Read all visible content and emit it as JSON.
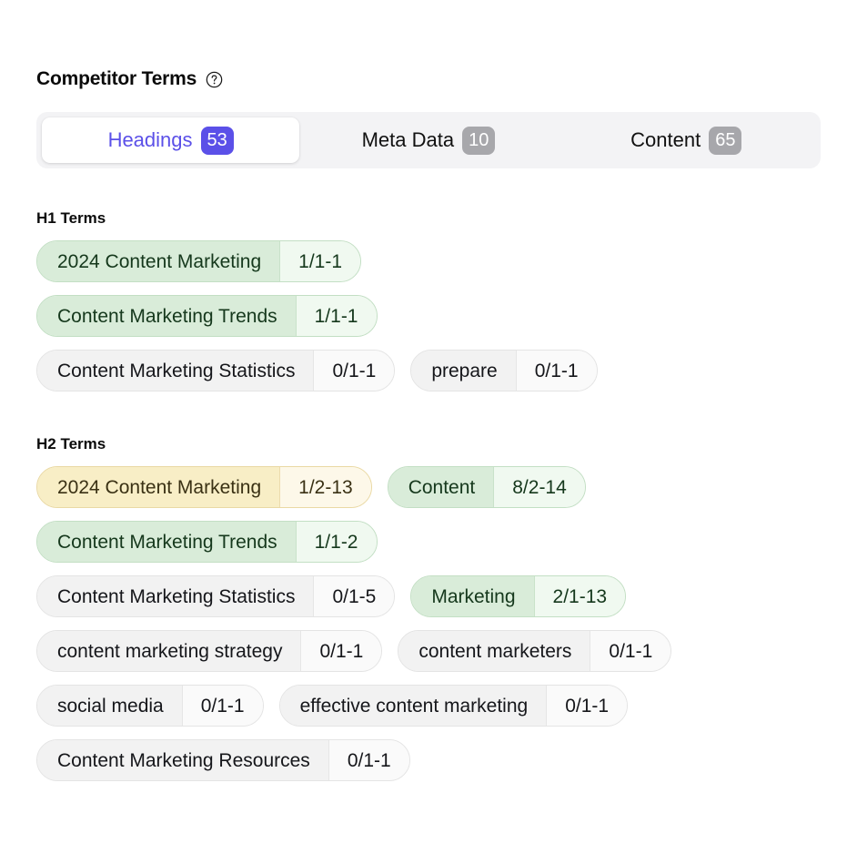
{
  "panel": {
    "title": "Competitor Terms",
    "help_icon": "question-circle-icon"
  },
  "tabs": [
    {
      "label": "Headings",
      "count": "53",
      "active": true
    },
    {
      "label": "Meta Data",
      "count": "10",
      "active": false
    },
    {
      "label": "Content",
      "count": "65",
      "active": false
    }
  ],
  "colors": {
    "accent": "#5b50e8",
    "tab_bar_bg": "#f3f3f5",
    "badge_inactive": "#a7a7ab",
    "chip_green_bg": "#d9ecd9",
    "chip_green_count_bg": "#f0f9f0",
    "chip_yellow_bg": "#f8eec6",
    "chip_yellow_count_bg": "#fdf8e9",
    "chip_gray_bg": "#f2f2f2",
    "chip_gray_count_bg": "#fafafa"
  },
  "sections": [
    {
      "title": "H1 Terms",
      "rows": [
        [
          {
            "term": "2024 Content Marketing",
            "count": "1/1-1",
            "variant": "green"
          }
        ],
        [
          {
            "term": "Content Marketing Trends",
            "count": "1/1-1",
            "variant": "green"
          }
        ],
        [
          {
            "term": "Content Marketing Statistics",
            "count": "0/1-1",
            "variant": "gray"
          },
          {
            "term": "prepare",
            "count": "0/1-1",
            "variant": "gray"
          }
        ]
      ]
    },
    {
      "title": "H2 Terms",
      "rows": [
        [
          {
            "term": "2024 Content Marketing",
            "count": "1/2-13",
            "variant": "yellow"
          },
          {
            "term": "Content",
            "count": "8/2-14",
            "variant": "green"
          }
        ],
        [
          {
            "term": "Content Marketing Trends",
            "count": "1/1-2",
            "variant": "green"
          }
        ],
        [
          {
            "term": "Content Marketing Statistics",
            "count": "0/1-5",
            "variant": "gray"
          },
          {
            "term": "Marketing",
            "count": "2/1-13",
            "variant": "green"
          }
        ],
        [
          {
            "term": "content marketing strategy",
            "count": "0/1-1",
            "variant": "gray"
          },
          {
            "term": "content marketers",
            "count": "0/1-1",
            "variant": "gray"
          }
        ],
        [
          {
            "term": "social media",
            "count": "0/1-1",
            "variant": "gray"
          },
          {
            "term": "effective content marketing",
            "count": "0/1-1",
            "variant": "gray"
          }
        ],
        [
          {
            "term": "Content Marketing Resources",
            "count": "0/1-1",
            "variant": "gray"
          }
        ]
      ]
    }
  ]
}
